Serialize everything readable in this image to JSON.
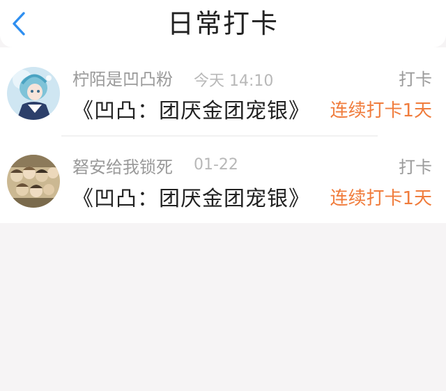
{
  "header": {
    "back_icon": "chevron-left-icon",
    "title": "日常打卡"
  },
  "colors": {
    "accent_blue": "#2f8ff0",
    "streak_orange": "#f07c3c",
    "muted_text": "#9a9a9a",
    "background": "#f6f4f5"
  },
  "checkins": [
    {
      "username": "柠陌是凹凸粉",
      "time": "今天 14:10",
      "action": "打卡",
      "topic": "《凹凸：团厌金团宠银》",
      "streak": "连续打卡1天"
    },
    {
      "username": "砮安给我锁死",
      "time": "01-22",
      "action": "打卡",
      "topic": "《凹凸：团厌金团宠银》",
      "streak": "连续打卡1天"
    }
  ]
}
